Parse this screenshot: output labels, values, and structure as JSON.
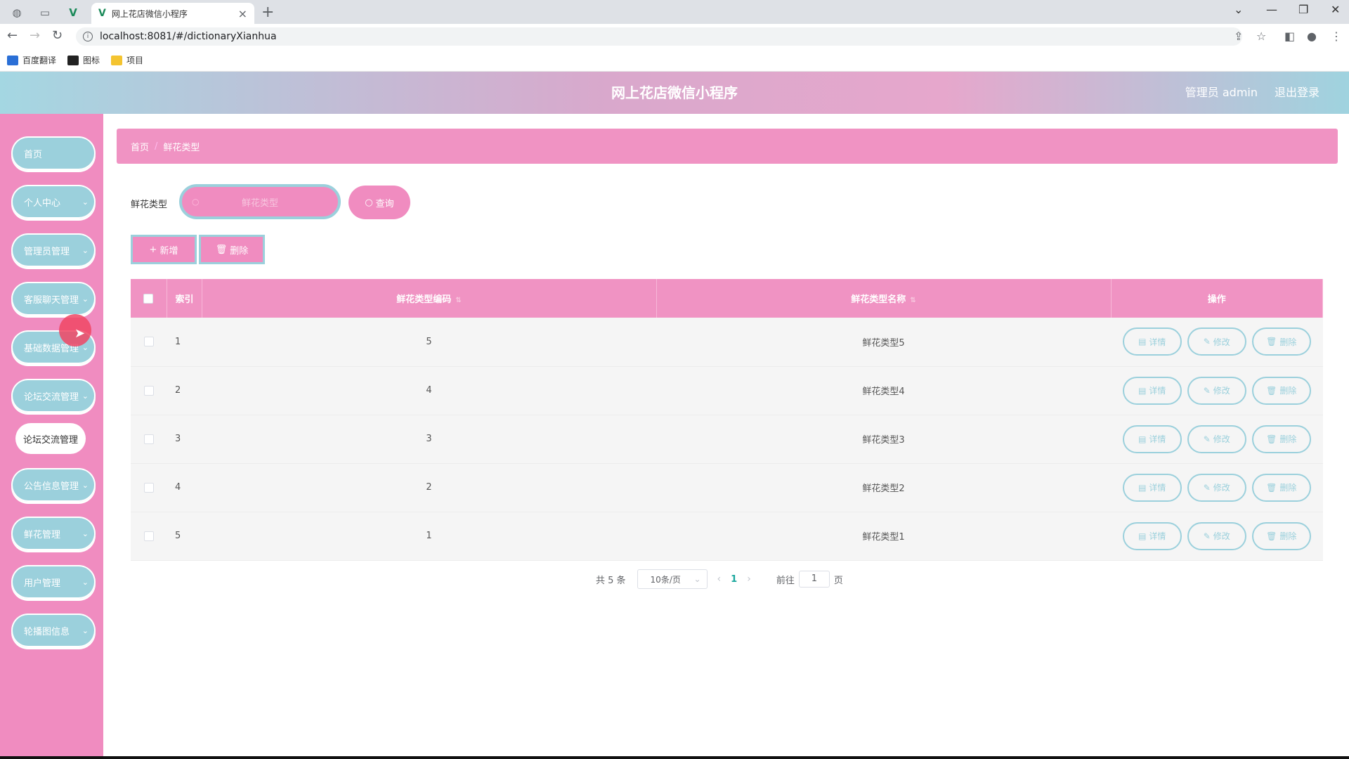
{
  "browser": {
    "tab_title": "网上花店微信小程序",
    "url": "localhost:8081/#/dictionaryXianhua",
    "bookmarks": [
      {
        "label": "百度翻译",
        "color": "#2a6fd6"
      },
      {
        "label": "图标",
        "color": "#222222"
      },
      {
        "label": "项目",
        "color": "#f4c430"
      }
    ]
  },
  "header": {
    "title": "网上花店微信小程序",
    "admin": "管理员 admin",
    "logout": "退出登录"
  },
  "sidebar": {
    "items": [
      {
        "label": "首页",
        "has_chevron": false
      },
      {
        "label": "个人中心",
        "has_chevron": true
      },
      {
        "label": "管理员管理",
        "has_chevron": true
      },
      {
        "label": "客服聊天管理",
        "has_chevron": true
      },
      {
        "label": "基础数据管理",
        "has_chevron": true
      },
      {
        "label": "论坛交流管理",
        "has_chevron": true
      },
      {
        "label": "公告信息管理",
        "has_chevron": true
      },
      {
        "label": "鲜花管理",
        "has_chevron": true
      },
      {
        "label": "用户管理",
        "has_chevron": true
      },
      {
        "label": "轮播图信息",
        "has_chevron": true
      }
    ],
    "expanded_sub": "论坛交流管理"
  },
  "breadcrumb": {
    "home": "首页",
    "current": "鲜花类型"
  },
  "search": {
    "label": "鲜花类型",
    "placeholder": "鲜花类型",
    "query_button": "查询"
  },
  "actions": {
    "add": "新增",
    "delete": "删除"
  },
  "table": {
    "headers": {
      "index": "索引",
      "code": "鲜花类型编码",
      "name": "鲜花类型名称",
      "ops": "操作"
    },
    "rows": [
      {
        "index": "1",
        "code": "5",
        "name": "鲜花类型5"
      },
      {
        "index": "2",
        "code": "4",
        "name": "鲜花类型4"
      },
      {
        "index": "3",
        "code": "3",
        "name": "鲜花类型3"
      },
      {
        "index": "4",
        "code": "2",
        "name": "鲜花类型2"
      },
      {
        "index": "5",
        "code": "1",
        "name": "鲜花类型1"
      }
    ],
    "row_buttons": {
      "detail": "详情",
      "edit": "修改",
      "delete": "删除"
    }
  },
  "pagination": {
    "total": "共 5 条",
    "page_size": "10条/页",
    "current_page": "1",
    "goto_prefix": "前往",
    "goto_value": "1",
    "goto_suffix": "页"
  },
  "colors": {
    "pink": "#f08cc0",
    "teal": "#9bd0dc",
    "active_page": "#1aa79d"
  }
}
